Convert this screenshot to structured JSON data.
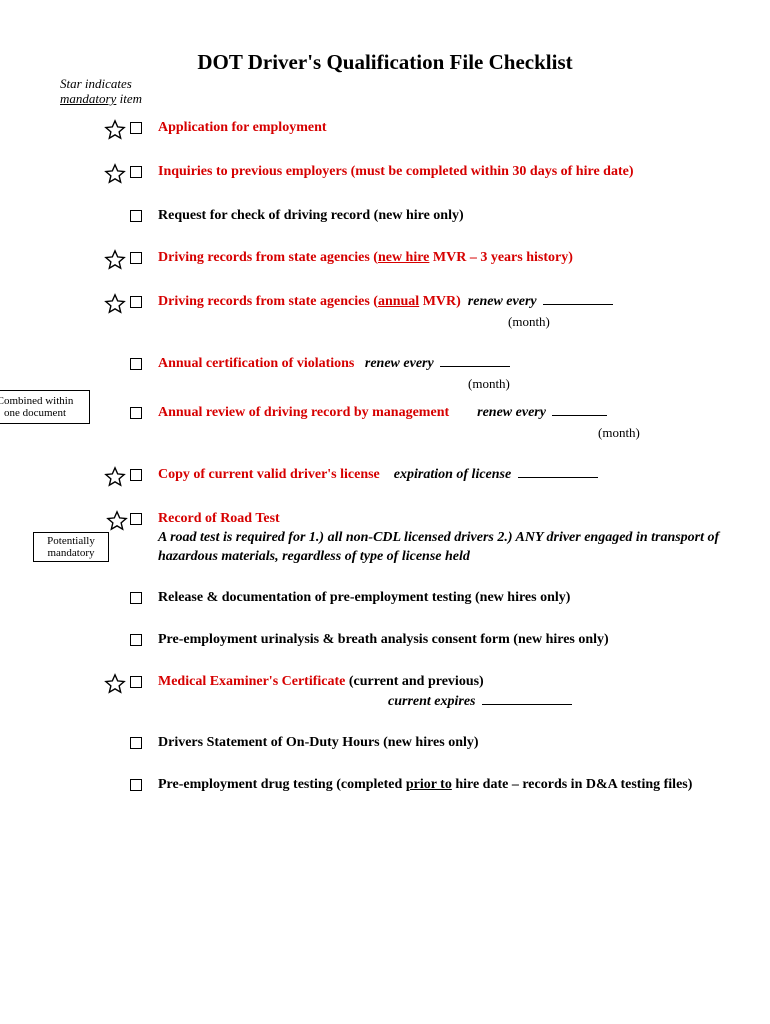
{
  "title": "DOT Driver's Qualification File Checklist",
  "legend": {
    "line1": "Star indicates",
    "line2_underlined": "mandatory",
    "line2_rest": " item"
  },
  "labels": {
    "month": "(month)",
    "combined1": "Combined within",
    "combined2": "one document",
    "potentially1": "Potentially",
    "potentially2": "mandatory"
  },
  "items": {
    "app": "Application for employment",
    "inquiries": "Inquiries to previous employers (must be completed within 30 days of hire date)",
    "request": "Request for check of driving record (new hire only)",
    "driving_new_pre": "Driving records from state agencies (",
    "driving_new_u": "new hire",
    "driving_new_post": " MVR – 3 years history)",
    "driving_annual_pre": "Driving records from state agencies (",
    "driving_annual_u": "annual",
    "driving_annual_post": " MVR)",
    "renew_every": "renew every",
    "annual_cert": "Annual certification of violations",
    "annual_review": "Annual review of driving record by management",
    "copy_license": "Copy of current valid driver's license",
    "expiration": "expiration of license",
    "road_test_title": "Record of Road Test",
    "road_test_desc": "A road test is required for 1.) all non-CDL licensed drivers  2.) ANY driver engaged in transport of hazardous materials, regardless of type of license held",
    "release": "Release & documentation of pre-employment testing (new hires only)",
    "urinalysis": "Pre-employment urinalysis & breath analysis consent form (new hires only)",
    "medical": "Medical Examiner's Certificate",
    "medical_suffix": " (current and previous)",
    "current_expires": "current expires",
    "onduty": "Drivers Statement of On-Duty Hours (new hires only)",
    "drug_pre": "Pre-employment drug testing (completed ",
    "drug_u": "prior to",
    "drug_post": " hire date – records in D&A testing files)"
  }
}
